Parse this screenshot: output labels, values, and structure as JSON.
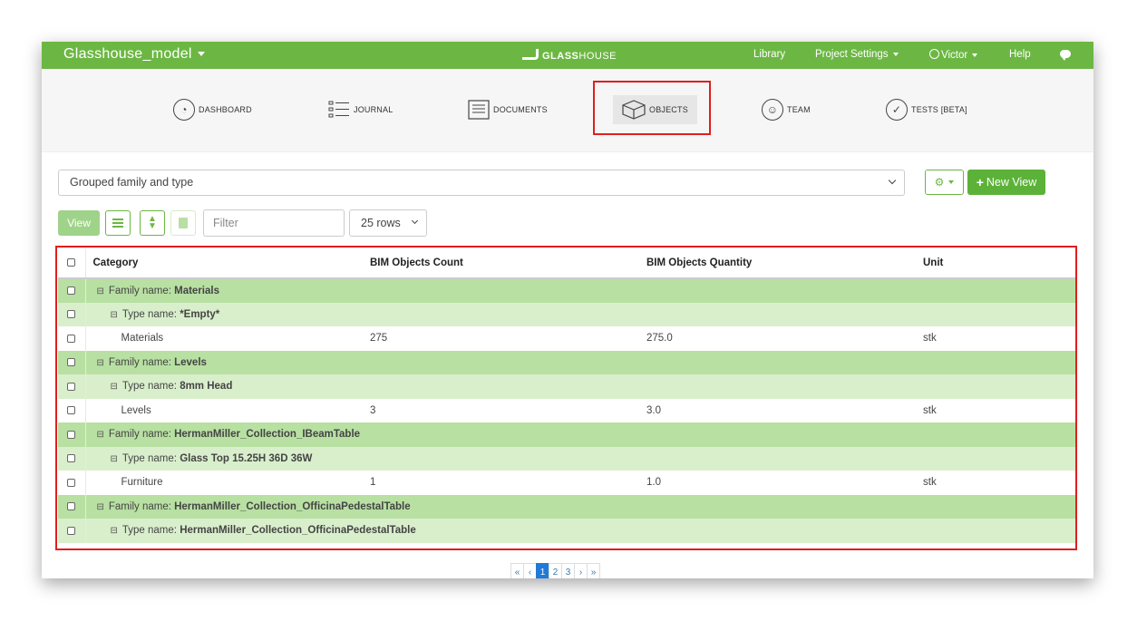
{
  "topbar": {
    "project_name": "Glasshouse_model",
    "logo_bold": "GLASS",
    "logo_light": "HOUSE",
    "nav": {
      "library": "Library",
      "project_settings": "Project Settings",
      "user": "Victor",
      "help": "Help"
    }
  },
  "modules": {
    "dashboard": "DASHBOARD",
    "journal": "JOURNAL",
    "documents": "DOCUMENTS",
    "objects": "OBJECTS",
    "team": "TEAM",
    "tests": "TESTS [BETA]"
  },
  "view_select": {
    "selected": "Grouped family and type"
  },
  "buttons": {
    "new_view": "New View",
    "view": "View"
  },
  "filter": {
    "placeholder": "Filter"
  },
  "rows_select": {
    "selected": "25 rows"
  },
  "table": {
    "headers": {
      "category": "Category",
      "count": "BIM Objects Count",
      "quantity": "BIM Objects Quantity",
      "unit": "Unit"
    },
    "rows": [
      {
        "kind": "family",
        "prefix": "Family name: ",
        "name": "Materials"
      },
      {
        "kind": "type",
        "prefix": "Type name: ",
        "name": "*Empty*"
      },
      {
        "kind": "item",
        "category": "Materials",
        "count": "275",
        "quantity": "275.0",
        "unit": "stk"
      },
      {
        "kind": "family",
        "prefix": "Family name: ",
        "name": "Levels"
      },
      {
        "kind": "type",
        "prefix": "Type name: ",
        "name": "8mm Head"
      },
      {
        "kind": "item",
        "category": "Levels",
        "count": "3",
        "quantity": "3.0",
        "unit": "stk"
      },
      {
        "kind": "family",
        "prefix": "Family name: ",
        "name": "HermanMiller_Collection_IBeamTable"
      },
      {
        "kind": "type",
        "prefix": "Type name: ",
        "name": "Glass Top 15.25H 36D 36W"
      },
      {
        "kind": "item",
        "category": "Furniture",
        "count": "1",
        "quantity": "1.0",
        "unit": "stk"
      },
      {
        "kind": "family",
        "prefix": "Family name: ",
        "name": "HermanMiller_Collection_OfficinaPedestalTable"
      },
      {
        "kind": "type",
        "prefix": "Type name: ",
        "name": "HermanMiller_Collection_OfficinaPedestalTable"
      }
    ]
  },
  "pagination": {
    "first": "«",
    "prev": "‹",
    "pages": [
      "1",
      "2",
      "3"
    ],
    "next": "›",
    "last": "»",
    "current_page": 1
  },
  "colors": {
    "brand_green": "#6cb743",
    "family_row": "#b8e0a2",
    "type_row": "#d9efcc",
    "annotation_red": "#e01e1e",
    "active_page": "#1f7ad8"
  }
}
